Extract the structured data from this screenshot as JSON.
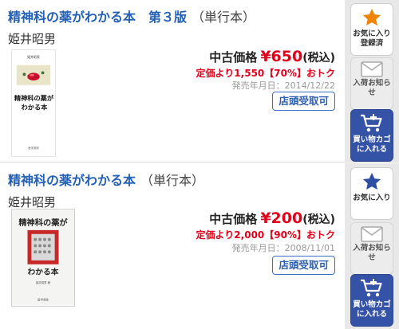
{
  "items": [
    {
      "title": "精神科の薬がわかる本　第３版",
      "format": "（単行本）",
      "author": "姫井昭男",
      "cover_title": "精神科の薬が わかる本",
      "price_label": "中古価格",
      "price": "¥650",
      "tax": "(税込)",
      "discount": "定価より1,550【70%】おトク",
      "release": "発売年月日：2014/12/22",
      "pickup_label": "店頭受取可",
      "favorite_label": "お気に入り登録済",
      "notify_label": "入荷お知らせ",
      "cart_label": "買い物カゴに入れる"
    },
    {
      "title": "精神科の薬がわかる本",
      "format": "（単行本）",
      "author": "姫井昭男",
      "cover_title": "精神科の薬が わかる本",
      "price_label": "中古価格",
      "price": "¥200",
      "tax": "(税込)",
      "discount": "定価より2,000【90%】おトク",
      "release": "発売年月日：2008/11/01",
      "pickup_label": "店頭受取可",
      "favorite_label": "お気に入り",
      "notify_label": "入荷お知らせ",
      "cart_label": "買い物カゴに入れる"
    }
  ],
  "colors": {
    "title": "#2360b7",
    "price": "#e2001a",
    "favorite_star_saved": "#f08300",
    "favorite_star": "#2d4fa3",
    "cart_button": "#3452a6"
  },
  "icons": [
    "star-icon",
    "mail-icon",
    "cart-icon"
  ]
}
